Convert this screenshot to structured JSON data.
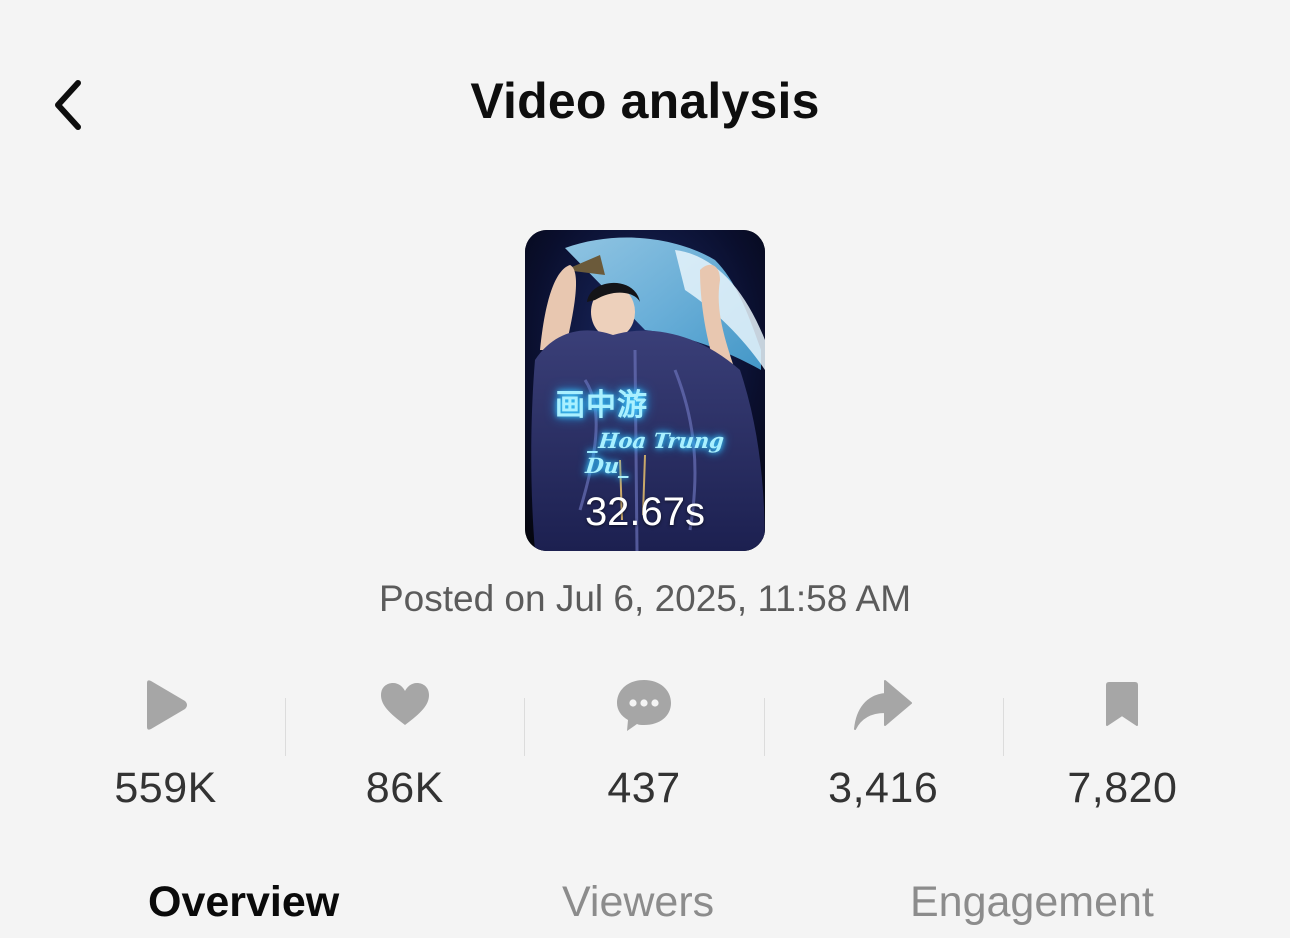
{
  "header": {
    "title": "Video analysis",
    "back_icon": "chevron-left-icon"
  },
  "video": {
    "overlay_title": "画中游",
    "overlay_subtitle": "_Hoa Trung Du_",
    "duration": "32.67s",
    "posted": "Posted on Jul 6, 2025, 11:58 AM"
  },
  "stats": [
    {
      "icon": "play-icon",
      "value": "559K"
    },
    {
      "icon": "heart-icon",
      "value": "86K"
    },
    {
      "icon": "comment-icon",
      "value": "437"
    },
    {
      "icon": "share-icon",
      "value": "3,416"
    },
    {
      "icon": "bookmark-icon",
      "value": "7,820"
    }
  ],
  "tabs": [
    {
      "label": "Overview",
      "active": true
    },
    {
      "label": "Viewers",
      "active": false
    },
    {
      "label": "Engagement",
      "active": false
    }
  ],
  "colors": {
    "background": "#f4f4f4",
    "icon_gray": "#a6a6a6",
    "stat_text": "#333333",
    "inactive_tab": "#8c8c8c"
  }
}
